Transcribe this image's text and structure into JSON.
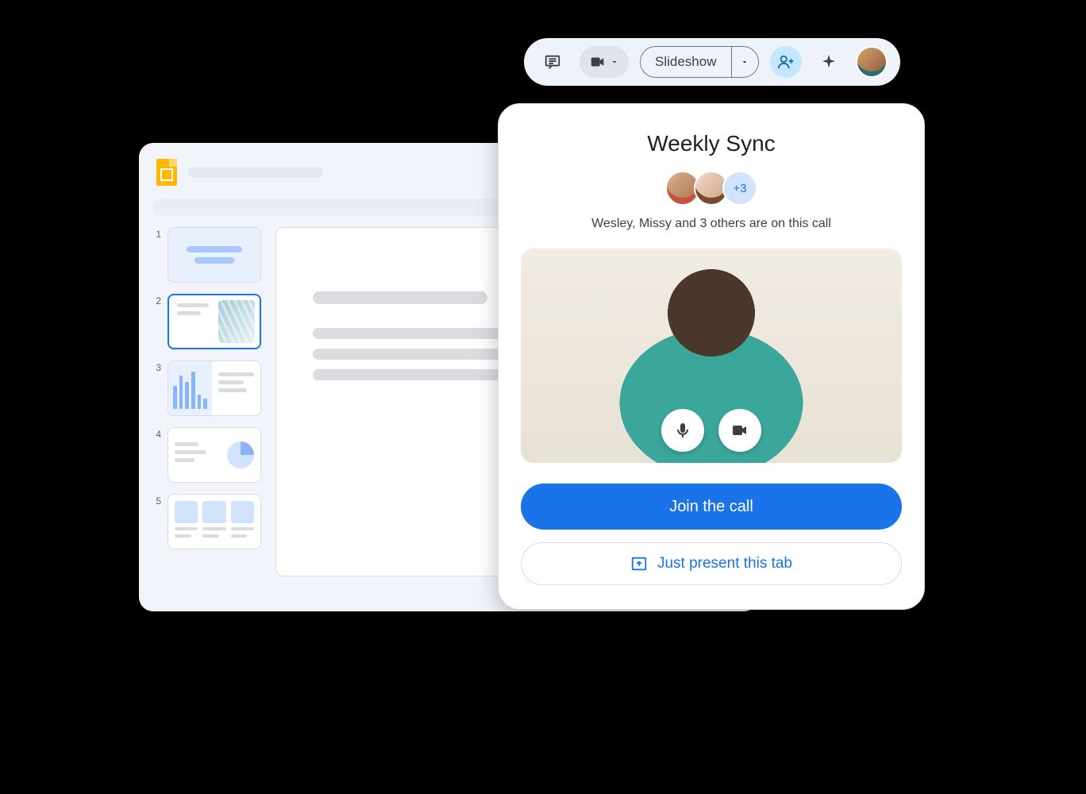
{
  "toolbar": {
    "slideshow_label": "Slideshow"
  },
  "slides": {
    "thumbs": [
      "1",
      "2",
      "3",
      "4",
      "5"
    ],
    "selected": 2
  },
  "meet": {
    "title": "Weekly Sync",
    "more_count": "+3",
    "subtitle": "Wesley, Missy and 3 others are on this call",
    "join_label": "Join the call",
    "present_label": "Just present this tab"
  }
}
